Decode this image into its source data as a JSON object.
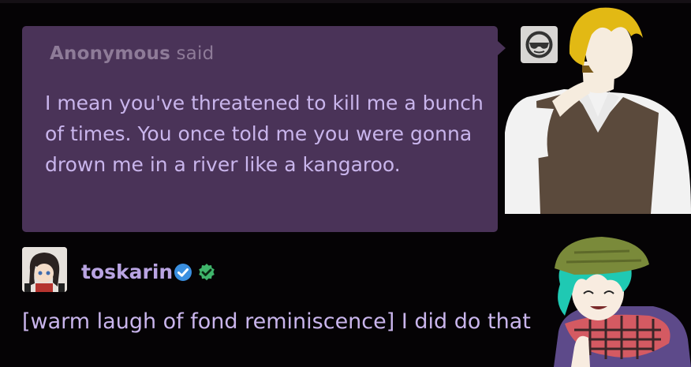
{
  "ask": {
    "asker_name": "Anonymous",
    "asker_verb": "said",
    "text": "I mean you've threatened to kill me a bunch of times. You once told me you were gonna drown me in a river like a kangaroo."
  },
  "reply": {
    "username": "toskarin",
    "text": "[warm laugh of fond reminiscence] I did do that"
  },
  "icons": {
    "anon_avatar": "anonymous-sunglasses-icon",
    "verified": "blue-check-badge-icon",
    "extra_badge": "green-check-badge-icon"
  },
  "colors": {
    "background": "#050305",
    "bubble": "#4a3358",
    "text": "#c9b5ec",
    "asker_label": "#8e7b98",
    "username": "#b9a4e2",
    "verified_blue": "#3a8fe0",
    "badge_green": "#3fb56b"
  }
}
